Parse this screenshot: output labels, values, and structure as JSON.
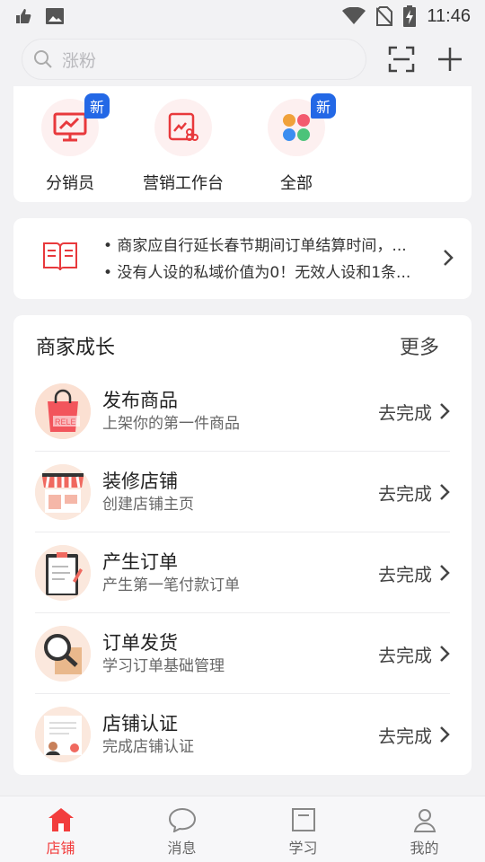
{
  "status_bar": {
    "time": "11:46"
  },
  "header": {
    "search_placeholder": "涨粉"
  },
  "tiles": [
    {
      "label": "分销员",
      "badge": "新",
      "icon": "monitor-chart-icon"
    },
    {
      "label": "营销工作台",
      "badge": "",
      "icon": "marketing-icon"
    },
    {
      "label": "全部",
      "badge": "新",
      "icon": "apps-icon"
    }
  ],
  "notice": {
    "lines": [
      "• 商家应自行延长春节期间订单结算时间，...",
      "• 没有人设的私域价值为0！无效人设和1条..."
    ]
  },
  "growth": {
    "title": "商家成长",
    "more": "更多",
    "tasks": [
      {
        "title": "发布商品",
        "subtitle": "上架你的第一件商品",
        "action": "去完成",
        "icon": "shopping-bag-icon"
      },
      {
        "title": "装修店铺",
        "subtitle": "创建店铺主页",
        "action": "去完成",
        "icon": "storefront-icon"
      },
      {
        "title": "产生订单",
        "subtitle": "产生第一笔付款订单",
        "action": "去完成",
        "icon": "clipboard-icon"
      },
      {
        "title": "订单发货",
        "subtitle": "学习订单基础管理",
        "action": "去完成",
        "icon": "magnifier-box-icon"
      },
      {
        "title": "店铺认证",
        "subtitle": "完成店铺认证",
        "action": "去完成",
        "icon": "certificate-icon"
      }
    ]
  },
  "bottom_nav": [
    {
      "label": "店铺",
      "active": true
    },
    {
      "label": "消息",
      "active": false
    },
    {
      "label": "学习",
      "active": false
    },
    {
      "label": "我的",
      "active": false
    }
  ],
  "colors": {
    "accent": "#f23d3d",
    "badge": "#2368e6"
  }
}
